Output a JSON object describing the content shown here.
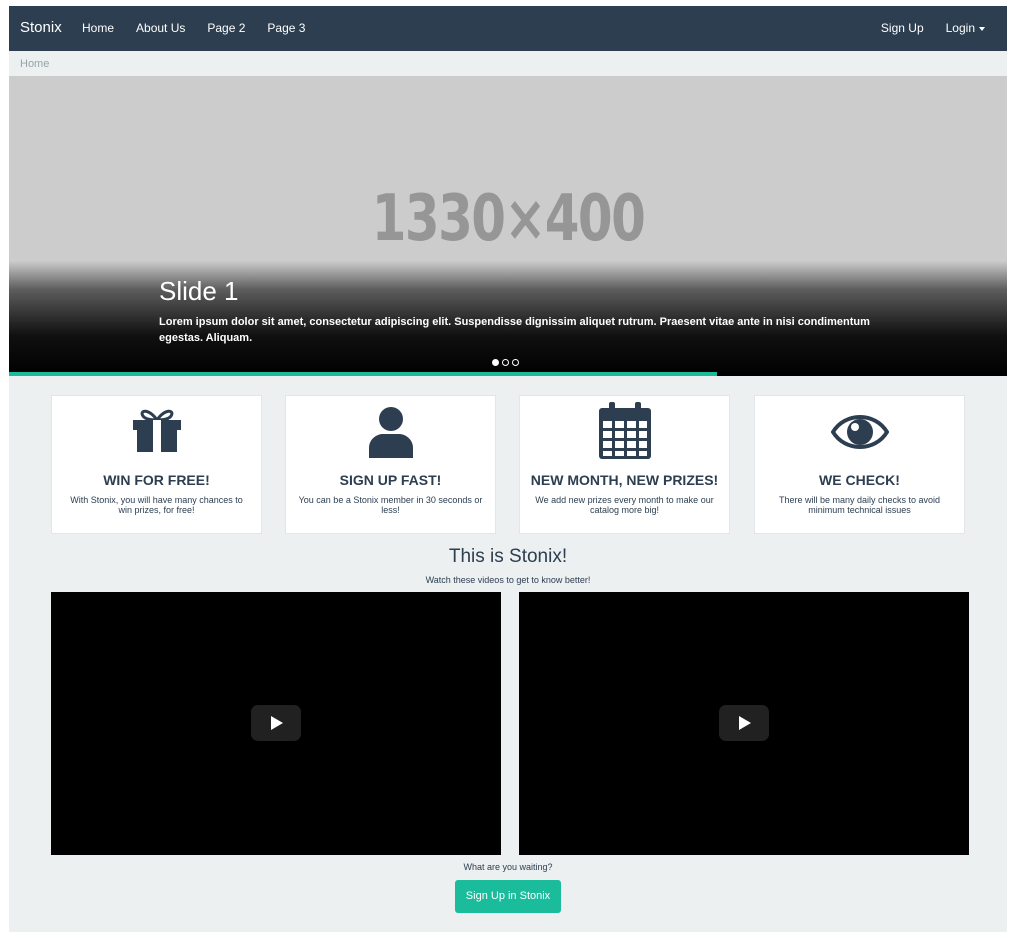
{
  "navbar": {
    "brand": "Stonix",
    "links": [
      "Home",
      "About Us",
      "Page 2",
      "Page 3"
    ],
    "signup": "Sign Up",
    "login": "Login"
  },
  "breadcrumb": "Home",
  "carousel": {
    "placeholder": "1330×400",
    "slide_title": "Slide 1",
    "slide_text": "Lorem ipsum dolor sit amet, consectetur adipiscing elit. Suspendisse dignissim aliquet rutrum. Praesent vitae ante in nisi condimentum egestas. Aliquam.",
    "indicators": 3,
    "active_indicator": 1
  },
  "features": [
    {
      "icon": "gift-icon",
      "title": "WIN FOR FREE!",
      "text": "With Stonix, you will have many chances to win prizes, for free!"
    },
    {
      "icon": "user-icon",
      "title": "SIGN UP FAST!",
      "text": "You can be a Stonix member in 30 seconds or less!"
    },
    {
      "icon": "calendar-icon",
      "title": "NEW MONTH, NEW PRIZES!",
      "text": "We add new prizes every month to make our catalog more big!"
    },
    {
      "icon": "eye-icon",
      "title": "WE CHECK!",
      "text": "There will be many daily checks to avoid minimum technical issues"
    }
  ],
  "section": {
    "title": "This is Stonix!",
    "subtitle": "Watch these videos to get to know better!",
    "waiting": "What are you waiting?",
    "cta": "Sign Up in Stonix"
  },
  "colors": {
    "navbar": "#2c3e50",
    "accent": "#1abc9c",
    "background": "#ecf0f1"
  }
}
